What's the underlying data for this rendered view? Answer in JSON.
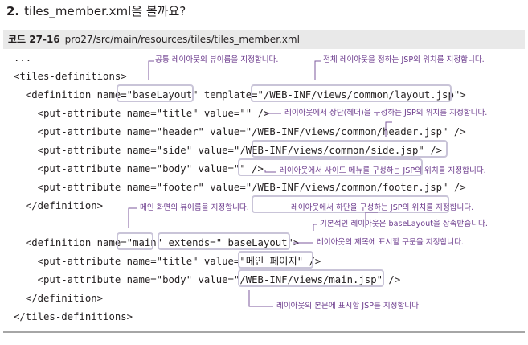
{
  "heading": {
    "number": "2.",
    "text": "tiles_member.xml을 볼까요?"
  },
  "listing": {
    "label": "코드 27-16",
    "path": "pro27/src/main/resources/tiles/tiles_member.xml"
  },
  "code_lines": [
    "...",
    "<tiles-definitions>",
    "  <definition name=\"baseLayout\" template=\"/WEB-INF/views/common/layout.jsp\">",
    "    <put-attribute name=\"title\" value=\"\" />",
    "    <put-attribute name=\"header\" value=\"/WEB-INF/views/common/header.jsp\" />",
    "    <put-attribute name=\"side\" value=\"/WEB-INF/views/common/side.jsp\" />",
    "    <put-attribute name=\"body\" value=\"\" />",
    "    <put-attribute name=\"footer\" value=\"/WEB-INF/views/common/footer.jsp\" />",
    "  </definition>",
    "",
    "  <definition name=\"main\" extends=\" baseLayout\">",
    "    <put-attribute name=\"title\" value=\"메인 페이지\" />",
    "    <put-attribute name=\"body\" value=\"/WEB-INF/views/main.jsp\" />",
    "  </definition>",
    "</tiles-definitions>"
  ],
  "callouts": {
    "common_view_name": "공통 레이아웃의 뷰이름을 지정합니다.",
    "whole_layout_jsp": "전체 레이아웃을 정하는 JSP의 위치를 지정합니다.",
    "header_jsp": "레이아웃에서 상단(헤더)을 구성하는 JSP의 위치를 지정합니다.",
    "side_jsp": "레이아웃에서 사이드 메뉴를 구성하는 JSP의 위치를 지정합니다.",
    "main_view_name": "메인 화면의 뷰이름을 지정합니다.",
    "footer_jsp": "레이아웃에서 하단을 구성하는 JSP의 위치를 지정합니다.",
    "extends_base": "기본적인 레이아웃은 baseLayout을 상속받습니다.",
    "title_text": "레이아웃의 제목에 표시할 구문을 지정합니다.",
    "body_jsp": "레이아웃의 본문에 표시할 JSP를 지정합니다."
  },
  "colors": {
    "callout_text": "#6b3a8c",
    "highlight_border": "#c9c4d8",
    "listing_bar": "#e9e9e9"
  }
}
